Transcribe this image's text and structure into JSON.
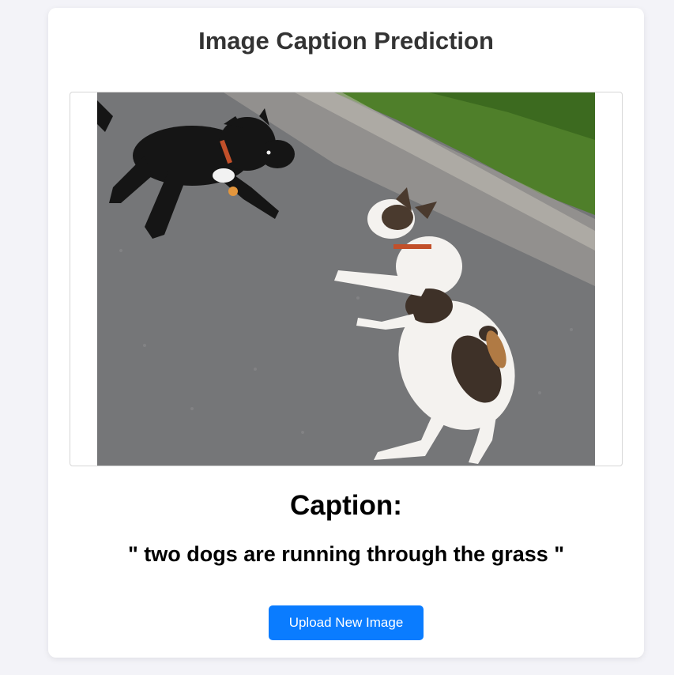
{
  "page": {
    "title": "Image Caption Prediction"
  },
  "image": {
    "subject": "two dogs playing on a road"
  },
  "caption": {
    "heading": "Caption:",
    "text": "\" two dogs are running through the grass \""
  },
  "actions": {
    "upload_label": "Upload New Image"
  },
  "colors": {
    "background": "#f3f3f8",
    "card": "#ffffff",
    "button": "#0a7cff",
    "title": "#333333"
  }
}
